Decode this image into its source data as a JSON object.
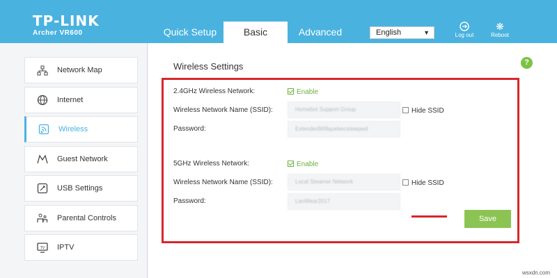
{
  "header": {
    "brand": "TP-LINK",
    "model": "Archer VR600",
    "tabs": [
      "Quick Setup",
      "Basic",
      "Advanced"
    ],
    "language": "English",
    "logout_label": "Log out",
    "reboot_label": "Reboot"
  },
  "sidebar": {
    "items": [
      {
        "label": "Network Map",
        "icon": "network-map-icon"
      },
      {
        "label": "Internet",
        "icon": "globe-icon"
      },
      {
        "label": "Wireless",
        "icon": "wireless-icon"
      },
      {
        "label": "Guest Network",
        "icon": "guest-icon"
      },
      {
        "label": "USB Settings",
        "icon": "usb-icon"
      },
      {
        "label": "Parental Controls",
        "icon": "parental-icon"
      },
      {
        "label": "IPTV",
        "icon": "tv-icon"
      }
    ]
  },
  "main": {
    "title": "Wireless Settings",
    "band24": {
      "label": "2.4GHz Wireless Network:",
      "enable_label": "Enable",
      "ssid_label": "Wireless Network Name (SSID):",
      "ssid_value": "Homebot Support Group",
      "hide_label": "Hide SSID",
      "password_label": "Password:",
      "password_value": "ExtendedWifiquebecstewpwd"
    },
    "band5": {
      "label": "5GHz Wireless Network:",
      "enable_label": "Enable",
      "ssid_label": "Wireless Network Name (SSID):",
      "ssid_value": "Local Steamer Network",
      "hide_label": "Hide SSID",
      "password_label": "Password:",
      "password_value": "LanWear2017"
    },
    "save_label": "Save"
  },
  "watermark": "wsxdn.com",
  "colors": {
    "header": "#4ab2df",
    "accent": "#4ab2df",
    "enable_green": "#6ab23b",
    "save_green": "#8cc453",
    "highlight_red": "#d8262a"
  }
}
